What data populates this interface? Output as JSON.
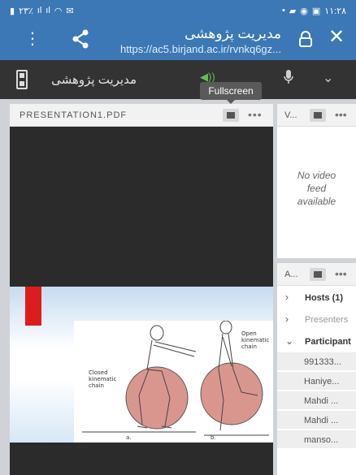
{
  "status_bar": {
    "left": "۲۳٪",
    "time": "۱۱:۲۸"
  },
  "browser": {
    "title": "مدیریت پژوهشی",
    "url": "https://ac5.birjand.ac.ir/rvnkq6gz..."
  },
  "app_header": {
    "room_name": "مدیریت پژوهشی"
  },
  "tooltip": "Fullscreen",
  "share_pod": {
    "title": "PRESENTATION1.PDF",
    "more": "•••"
  },
  "slide": {
    "labels": {
      "closed": "Closed kinematic chain",
      "open": "Open kinematic chain",
      "a": "a.",
      "b": "b."
    }
  },
  "video_pod": {
    "title": "V...",
    "more": "•••",
    "message_line1": "No video",
    "message_line2": "feed",
    "message_line3": "available"
  },
  "attendee_pod": {
    "title": "A...",
    "more": "•••",
    "groups": [
      {
        "label": "Hosts (1)"
      },
      {
        "label": "Presenters"
      },
      {
        "label": "Participant"
      }
    ],
    "participants": [
      "991333...",
      "Haniye...",
      "Mahdi ...",
      "Mahdi ...",
      "manso..."
    ]
  },
  "colors": {
    "accent": "#3c78b5",
    "header": "#333333",
    "speaker": "#5cc34a",
    "slide_red": "#dd1d1d"
  }
}
